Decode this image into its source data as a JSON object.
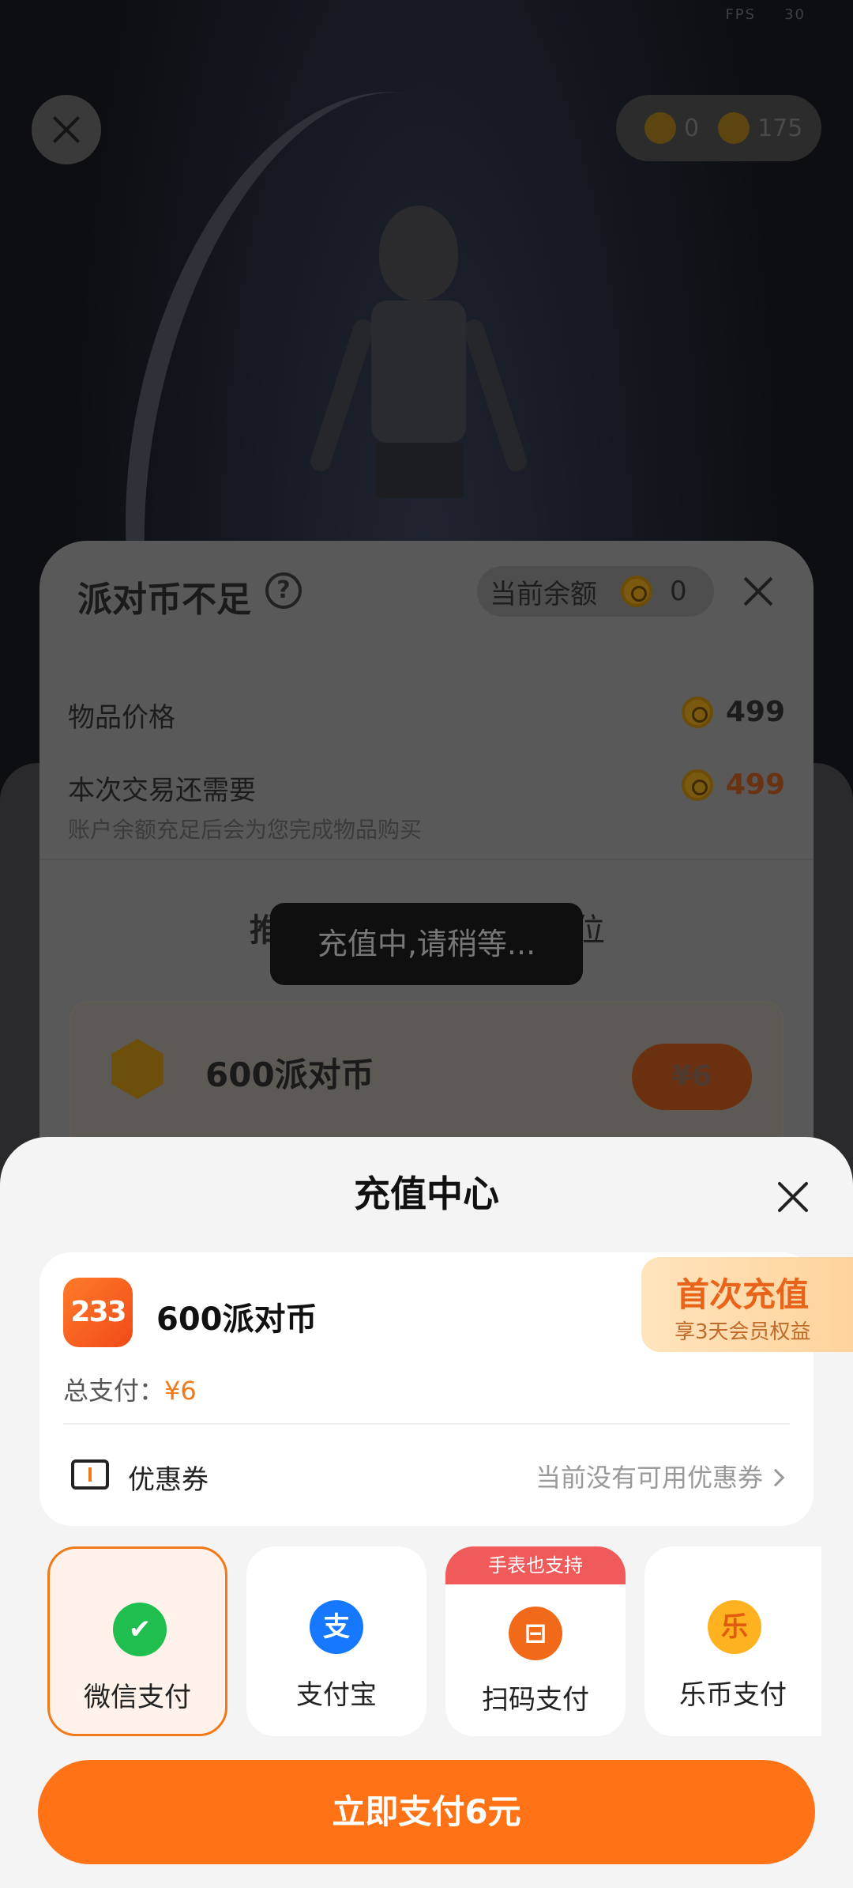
{
  "status": {
    "fps_label": "FPS",
    "fps_value": "30"
  },
  "top_bar": {
    "balance_a": "0",
    "balance_b": "175"
  },
  "dialog": {
    "title": "派对币不足",
    "balance_label": "当前余额",
    "balance_value": "0",
    "item_price_label": "物品价格",
    "item_price_value": "499",
    "need_label": "本次交易还需要",
    "need_value": "499",
    "hint": "账户余额充足后会为您完成物品购买",
    "recommend_left": "推",
    "recommend_right": "位",
    "package_name": "600派对币",
    "package_price": "¥6"
  },
  "toast": {
    "text": "充值中,请稍等..."
  },
  "sheet": {
    "title": "充值中心",
    "app_logo_text": "233",
    "product_name": "600派对币",
    "total_label": "总支付：",
    "total_value": "¥6",
    "promo_title": "首次充值",
    "promo_sub": "享3天会员权益",
    "coupon_label": "优惠券",
    "coupon_value": "当前没有可用优惠券",
    "payments": [
      {
        "label": "微信支付",
        "icon": "wechat-pay-icon",
        "selected": true
      },
      {
        "label": "支付宝",
        "icon": "alipay-icon",
        "selected": false
      },
      {
        "label": "扫码支付",
        "icon": "scan-pay-icon",
        "badge": "手表也支持",
        "selected": false
      },
      {
        "label": "乐币支付",
        "icon": "lebi-pay-icon",
        "icon_text": "乐",
        "selected": false
      }
    ],
    "pay_button": "立即支付6元"
  },
  "colors": {
    "accent": "#ff7316",
    "wechat": "#1fbe4e",
    "alipay": "#1677ff",
    "badge": "#f05a5a"
  }
}
